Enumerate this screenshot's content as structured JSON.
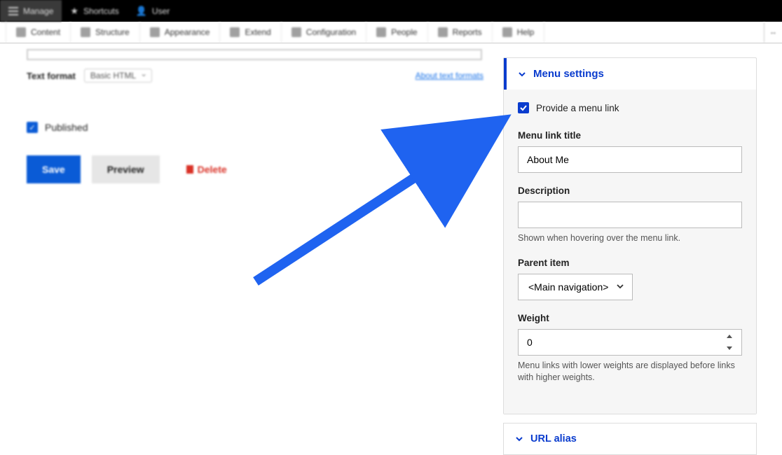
{
  "topbar": {
    "manage": "Manage",
    "shortcuts": "Shortcuts",
    "user": "User"
  },
  "toolbar": {
    "content": "Content",
    "structure": "Structure",
    "appearance": "Appearance",
    "extend": "Extend",
    "configuration": "Configuration",
    "people": "People",
    "reports": "Reports",
    "help": "Help",
    "orient": "↔"
  },
  "editor": {
    "format_label": "Text format",
    "format_value": "Basic HTML",
    "about_link": "About text formats",
    "published_label": "Published"
  },
  "buttons": {
    "save": "Save",
    "preview": "Preview",
    "delete": "Delete"
  },
  "menu_panel": {
    "header": "Menu settings",
    "provide_label": "Provide a menu link",
    "title_label": "Menu link title",
    "title_value": "About Me",
    "desc_label": "Description",
    "desc_value": "",
    "desc_help": "Shown when hovering over the menu link.",
    "parent_label": "Parent item",
    "parent_value": "<Main navigation>",
    "weight_label": "Weight",
    "weight_value": "0",
    "weight_help": "Menu links with lower weights are displayed before links with higher weights."
  },
  "url_panel": {
    "header": "URL alias"
  }
}
